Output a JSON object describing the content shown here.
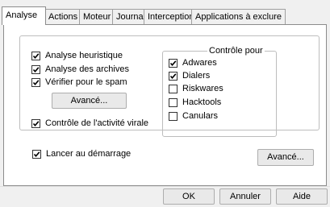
{
  "tabs": [
    {
      "label": "Analyse"
    },
    {
      "label": "Actions"
    },
    {
      "label": "Moteur"
    },
    {
      "label": "Journal"
    },
    {
      "label": "Interception"
    },
    {
      "label": "Applications à exclure"
    }
  ],
  "active_tab": "Analyse",
  "scan_options": [
    {
      "label": "Analyse heuristique",
      "checked": true
    },
    {
      "label": "Analyse des archives",
      "checked": true
    },
    {
      "label": "Vérifier pour le spam",
      "checked": true
    }
  ],
  "advanced_button_1": "Avancé...",
  "viral_control": {
    "label": "Contrôle de l'activité virale",
    "checked": true
  },
  "control_for": {
    "title": "Contrôle pour",
    "items": [
      {
        "label": "Adwares",
        "checked": true
      },
      {
        "label": "Dialers",
        "checked": true
      },
      {
        "label": "Riskwares",
        "checked": false
      },
      {
        "label": "Hacktools",
        "checked": false
      },
      {
        "label": "Canulars",
        "checked": false
      }
    ]
  },
  "startup": {
    "label": "Lancer au démarrage",
    "checked": true
  },
  "advanced_button_2": "Avancé...",
  "buttons": {
    "ok": "OK",
    "cancel": "Annuler",
    "help": "Aide"
  }
}
